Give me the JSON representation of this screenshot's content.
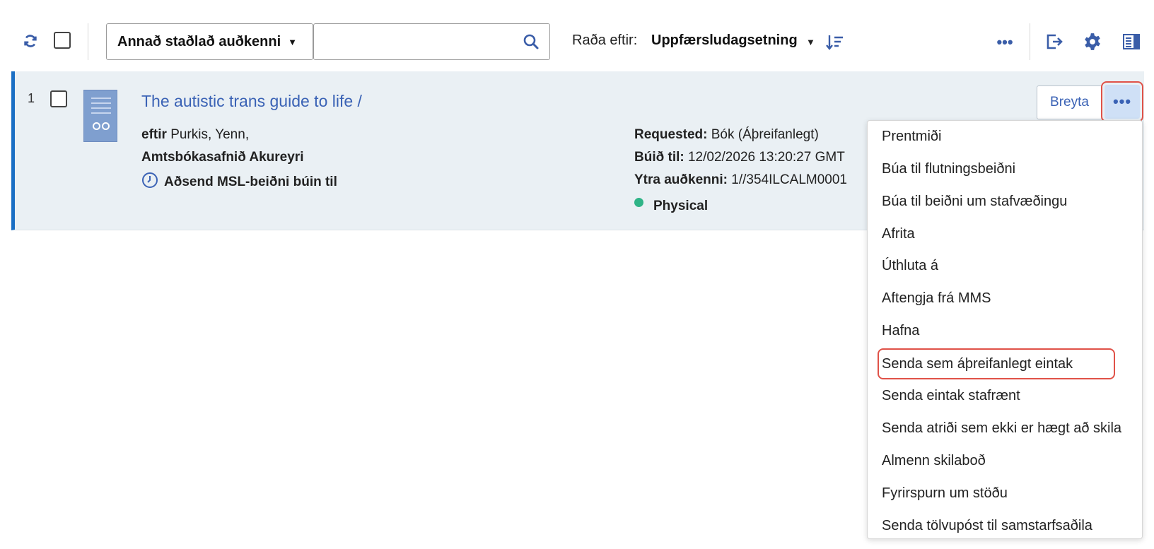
{
  "toolbar": {
    "search_field_select": "Annað staðlað auðkenni",
    "search_input_value": "",
    "sort_label": "Raða eftir:",
    "sort_value": "Uppfærsludagsetning"
  },
  "result": {
    "number": "1",
    "title": "The autistic trans guide to life /",
    "author_prefix": "eftir",
    "author": "Purkis, Yenn,",
    "library": "Amtsbókasafnið Akureyri",
    "status": "Aðsend MSL-beiðni búin til",
    "requested_label": "Requested:",
    "requested_value": "Bók (Áþreifanlegt)",
    "created_label": "Búið til:",
    "created_value": "12/02/2026 13:20:27 GMT",
    "external_id_label": "Ytra auðkenni:",
    "external_id_value": "1//354ILCALM0001",
    "format": "Physical",
    "edit_label": "Breyta",
    "format_dot_color": "#2fb487"
  },
  "menu": {
    "items": [
      "Prentmiði",
      "Búa til flutningsbeiðni",
      "Búa til beiðni um stafvæðingu",
      "Afrita",
      "Úthluta á",
      "Aftengja frá MMS",
      "Hafna",
      "Senda sem áþreifanlegt eintak",
      "Senda eintak stafrænt",
      "Senda atriði sem ekki er hægt að skila",
      "Almenn skilaboð",
      "Fyrirspurn um stöðu",
      "Senda tölvupóst til samstarfsaðila"
    ],
    "highlighted_item": "Senda sem áþreifanlegt eintak"
  },
  "colors": {
    "accent": "#3a62b5",
    "row_border": "#1a6fc4",
    "row_bg": "#eaf0f4",
    "highlight": "#e05248"
  }
}
